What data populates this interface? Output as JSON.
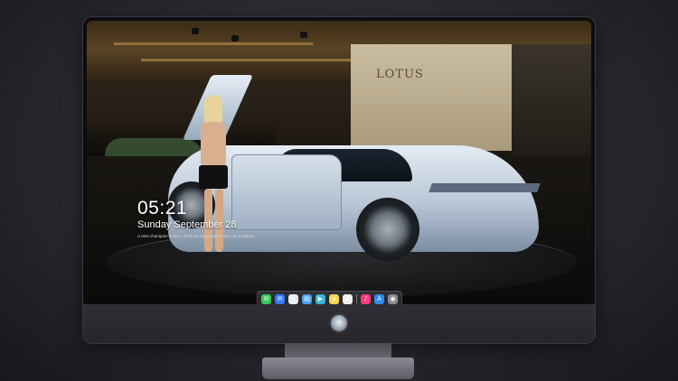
{
  "lock_screen": {
    "time": "05:21",
    "date": "Sunday September 28",
    "caption": "A new champion is born. Find out what makes this car a legend."
  },
  "wallpaper": {
    "brand_sign": "LOTUS"
  },
  "dock": {
    "items": [
      {
        "name": "messages-icon",
        "glyph": "✉",
        "color": "#35c759"
      },
      {
        "name": "mail-icon",
        "glyph": "✉",
        "color": "#2f7cf6"
      },
      {
        "name": "safari-icon",
        "glyph": "◎",
        "color": "#e9ecf1"
      },
      {
        "name": "files-icon",
        "glyph": "▤",
        "color": "#4aa3f0"
      },
      {
        "name": "clapper-icon",
        "glyph": "▶",
        "color": "#35b7d8"
      },
      {
        "name": "notes-icon",
        "glyph": "≡",
        "color": "#f7d451"
      },
      {
        "name": "photos-icon",
        "glyph": "✿",
        "color": "#f0f0f0"
      },
      {
        "name": "music-icon",
        "glyph": "♪",
        "color": "#f83b7a"
      },
      {
        "name": "app-store-icon",
        "glyph": "A",
        "color": "#2d8cf5"
      },
      {
        "name": "camera-icon",
        "glyph": "◉",
        "color": "#8a8a90"
      }
    ]
  }
}
